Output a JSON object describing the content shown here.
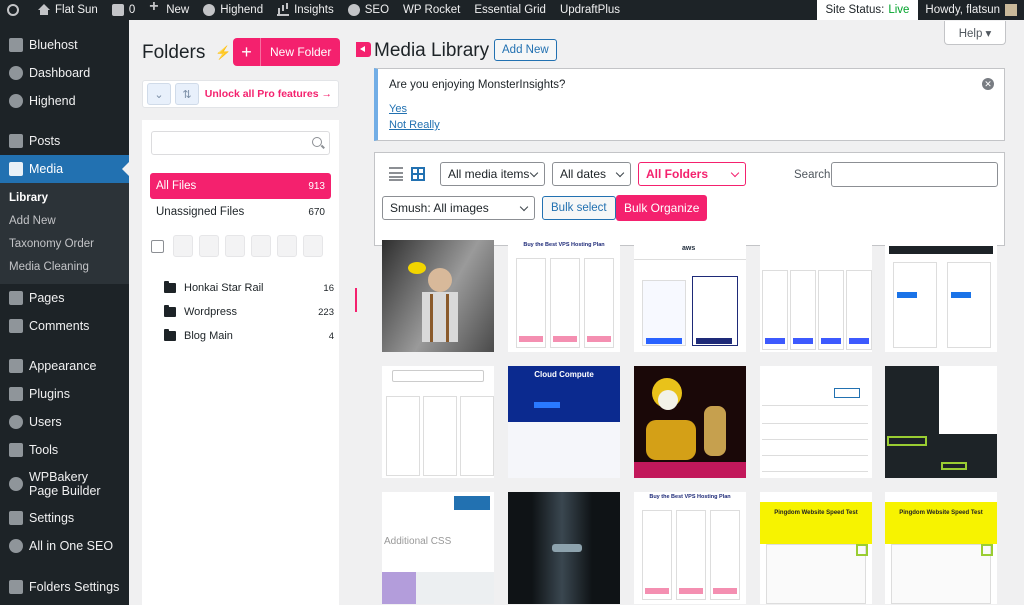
{
  "adminbar": {
    "site_name": "Flat Sun",
    "comments_count": "0",
    "new_label": "New",
    "theme_label": "Highend",
    "insights_label": "Insights",
    "seo_label": "SEO",
    "wprocket_label": "WP Rocket",
    "essentialgrid_label": "Essential Grid",
    "updraft_label": "UpdraftPlus",
    "site_status_label": "Site Status:",
    "site_status_value": "Live",
    "howdy": "Howdy, flatsun"
  },
  "sidebar": {
    "items": [
      {
        "label": "Bluehost"
      },
      {
        "label": "Dashboard"
      },
      {
        "label": "Highend"
      },
      {
        "label": "Posts"
      },
      {
        "label": "Media"
      },
      {
        "label": "Pages"
      },
      {
        "label": "Comments"
      },
      {
        "label": "Appearance"
      },
      {
        "label": "Plugins"
      },
      {
        "label": "Users"
      },
      {
        "label": "Tools"
      },
      {
        "label": "WPBakery Page Builder"
      },
      {
        "label": "Settings"
      },
      {
        "label": "All in One SEO"
      },
      {
        "label": "Folders Settings"
      }
    ],
    "submenu": [
      "Library",
      "Add New",
      "Taxonomy Order",
      "Media Cleaning"
    ]
  },
  "folders": {
    "title": "Folders",
    "new_folder": "New Folder",
    "unlock": "Unlock all Pro features →",
    "all_files": "All Files",
    "all_files_count": "913",
    "unassigned": "Unassigned Files",
    "unassigned_count": "670",
    "list": [
      {
        "name": "Honkai Star Rail",
        "count": "16"
      },
      {
        "name": "Wordpress",
        "count": "223"
      },
      {
        "name": "Blog Main",
        "count": "4"
      }
    ]
  },
  "main": {
    "title": "Media Library",
    "add_new": "Add New",
    "help": "Help ▾",
    "notice": {
      "question": "Are you enjoying MonsterInsights?",
      "yes": "Yes",
      "no": "Not Really"
    },
    "filters": {
      "media_items": "All media items",
      "dates": "All dates",
      "folders": "All Folders",
      "search_label": "Search",
      "smush": "Smush: All images",
      "bulk_select": "Bulk select",
      "bulk_organize": "Bulk Organize"
    },
    "tiles": [
      {
        "kind": "photo-man",
        "text": ""
      },
      {
        "kind": "pricing",
        "text": "Buy the Best VPS Hosting Plan"
      },
      {
        "kind": "aws",
        "text": "aws"
      },
      {
        "kind": "pricing4",
        "text": ""
      },
      {
        "kind": "pricing-dark",
        "text": ""
      },
      {
        "kind": "pricing-won",
        "text": ""
      },
      {
        "kind": "cloud",
        "text": "Cloud Compute"
      },
      {
        "kind": "clown",
        "text": ""
      },
      {
        "kind": "customizer",
        "text": ""
      },
      {
        "kind": "wp-menu",
        "text": ""
      },
      {
        "kind": "css",
        "text": "Additional CSS"
      },
      {
        "kind": "door",
        "text": ""
      },
      {
        "kind": "pricing",
        "text": "Buy the Best VPS Hosting Plan"
      },
      {
        "kind": "pingdom",
        "text": "Pingdom Website Speed Test"
      },
      {
        "kind": "pingdom",
        "text": "Pingdom Website Speed Test"
      }
    ]
  }
}
